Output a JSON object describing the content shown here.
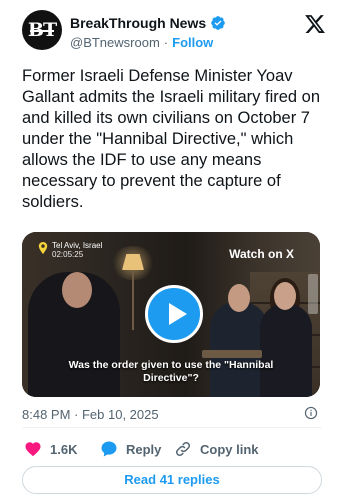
{
  "account": {
    "name": "BreakThrough News",
    "handle": "@BTnewsroom",
    "separator": "·",
    "follow_label": "Follow",
    "avatar_text": "BT",
    "verified": true
  },
  "tweet": {
    "text": "Former Israeli Defense Minister Yoav Gallant admits the Israeli military fired on and killed its own civilians on October 7 under the \"Hannibal Directive,\" which allows the IDF to use any means necessary to prevent the capture of soldiers."
  },
  "media": {
    "location": "Tel Aviv, Israel",
    "timecode": "02:05:25",
    "watch_label": "Watch on X",
    "subtitle": "Was the order given to use the \"Hannibal Directive\"?",
    "play_color": "#1d9bf0"
  },
  "meta": {
    "timestamp": "8:48 PM · Feb 10, 2025"
  },
  "actions": {
    "likes": "1.6K",
    "reply_label": "Reply",
    "copy_label": "Copy link",
    "like_color": "#f91880",
    "reply_color": "#1d9bf0"
  },
  "read_replies_label": "Read 41 replies",
  "colors": {
    "accent": "#1d9bf0",
    "text": "#0f1419",
    "muted": "#536471"
  }
}
